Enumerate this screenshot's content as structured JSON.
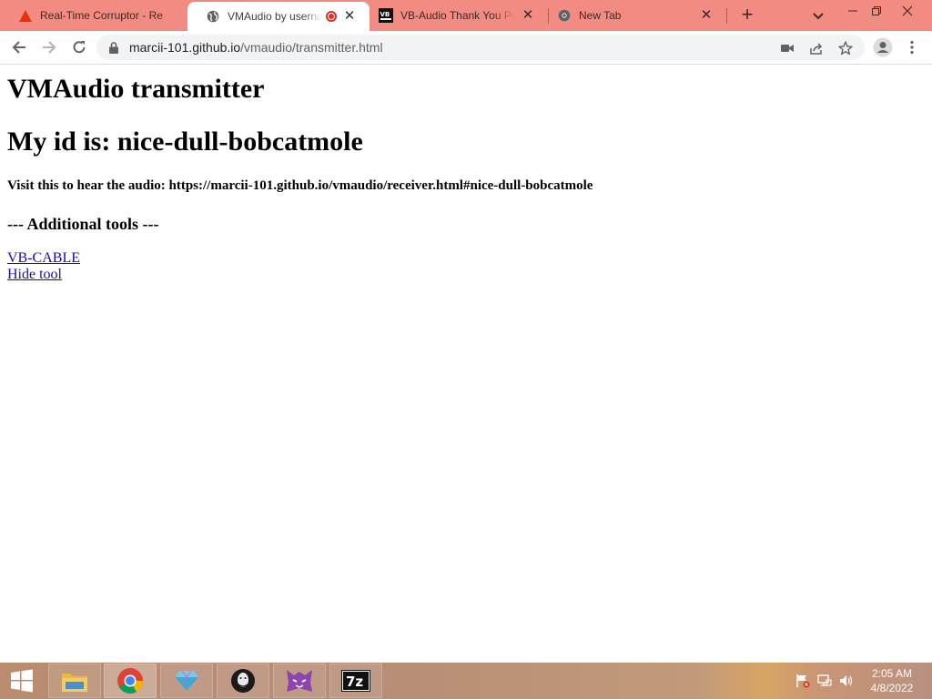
{
  "browser": {
    "tabs": [
      {
        "title": "Real-Time Corruptor - Re",
        "icon": "warning-triangle-icon",
        "active": false
      },
      {
        "title": "VMAudio by usernam",
        "icon": "globe-icon",
        "active": true,
        "recording": true
      },
      {
        "title": "VB-Audio Thank You Pag",
        "icon": "vb-audio-icon",
        "active": false
      },
      {
        "title": "New Tab",
        "icon": "chrome-icon",
        "active": false
      }
    ],
    "address": {
      "domain": "marcii-101.github.io",
      "path": "/vmaudio/transmitter.html"
    },
    "colors": {
      "frame": "#f28b82",
      "recording": "#d93025",
      "link": "#1a0dab"
    }
  },
  "page": {
    "title": "VMAudio transmitter",
    "id_line": "My id is: nice-dull-bobcatmole",
    "visit_line": "Visit this to hear the audio: https://marcii-101.github.io/vmaudio/receiver.html#nice-dull-bobcatmole",
    "tools_heading": "--- Additional tools ---",
    "links": [
      "VB-CABLE",
      "Hide tool"
    ]
  },
  "taskbar": {
    "apps": [
      "file-explorer-icon",
      "chrome-icon",
      "gem-app-icon",
      "anonymous-mask-icon",
      "cat-logo-icon",
      "7zip-icon"
    ],
    "clock": {
      "time": "2:05 AM",
      "date": "4/8/2022"
    }
  }
}
